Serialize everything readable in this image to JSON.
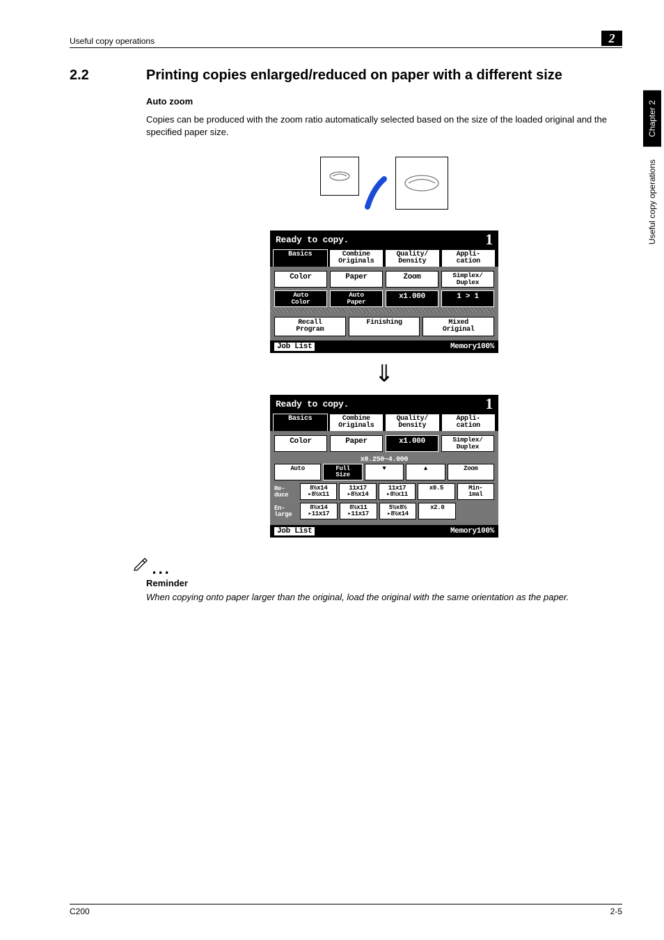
{
  "header": {
    "left": "Useful copy operations",
    "right_num": "2"
  },
  "side": {
    "chapter": "Chapter 2",
    "text": "Useful copy operations"
  },
  "section": {
    "num": "2.2",
    "title": "Printing copies enlarged/reduced on paper with a different size"
  },
  "subhead": "Auto zoom",
  "paragraph": "Copies can be produced with the zoom ratio automatically selected based on the size of the loaded original and the specified paper size.",
  "panel1": {
    "status": "Ready to copy.",
    "count": "1",
    "tabs": [
      "Basics",
      "Combine\nOriginals",
      "Quality/\nDensity",
      "Appli-\ncation"
    ],
    "row1": [
      "Color",
      "Paper",
      "Zoom",
      "Simplex/\nDuplex"
    ],
    "row2": [
      "Auto\nColor",
      "Auto\nPaper",
      "x1.000",
      "1 > 1"
    ],
    "btns": [
      "Recall\nProgram",
      "Finishing",
      "Mixed\nOriginal"
    ],
    "job": "Job List",
    "mem": "Memory100%"
  },
  "panel2": {
    "status": "Ready to copy.",
    "count": "1",
    "tabs": [
      "Basics",
      "Combine\nOriginals",
      "Quality/\nDensity",
      "Appli-\ncation"
    ],
    "row1": [
      "Color",
      "Paper",
      "x1.000",
      "Simplex/\nDuplex"
    ],
    "range": "x0.250~4.000",
    "row2": [
      "Auto",
      "Full\nSize",
      "▼",
      "▲",
      "Zoom"
    ],
    "reduce_lab": "Re-\nduce",
    "reduce": [
      "8½x14\n▸8½x11",
      "11x17\n▸8½x14",
      "11x17\n▸8½x11",
      "x0.5",
      "Min-\nimal"
    ],
    "enlarge_lab": "En-\nlarge",
    "enlarge": [
      "8½x14\n▸11x17",
      "8½x11\n▸11x17",
      "5½x8½\n▸8½x14",
      "x2.0",
      ""
    ],
    "job": "Job List",
    "mem": "Memory100%"
  },
  "note": {
    "head": "Reminder",
    "body": "When copying onto paper larger than the original, load the original with the same orientation as the paper."
  },
  "footer": {
    "left": "C200",
    "right": "2-5"
  }
}
